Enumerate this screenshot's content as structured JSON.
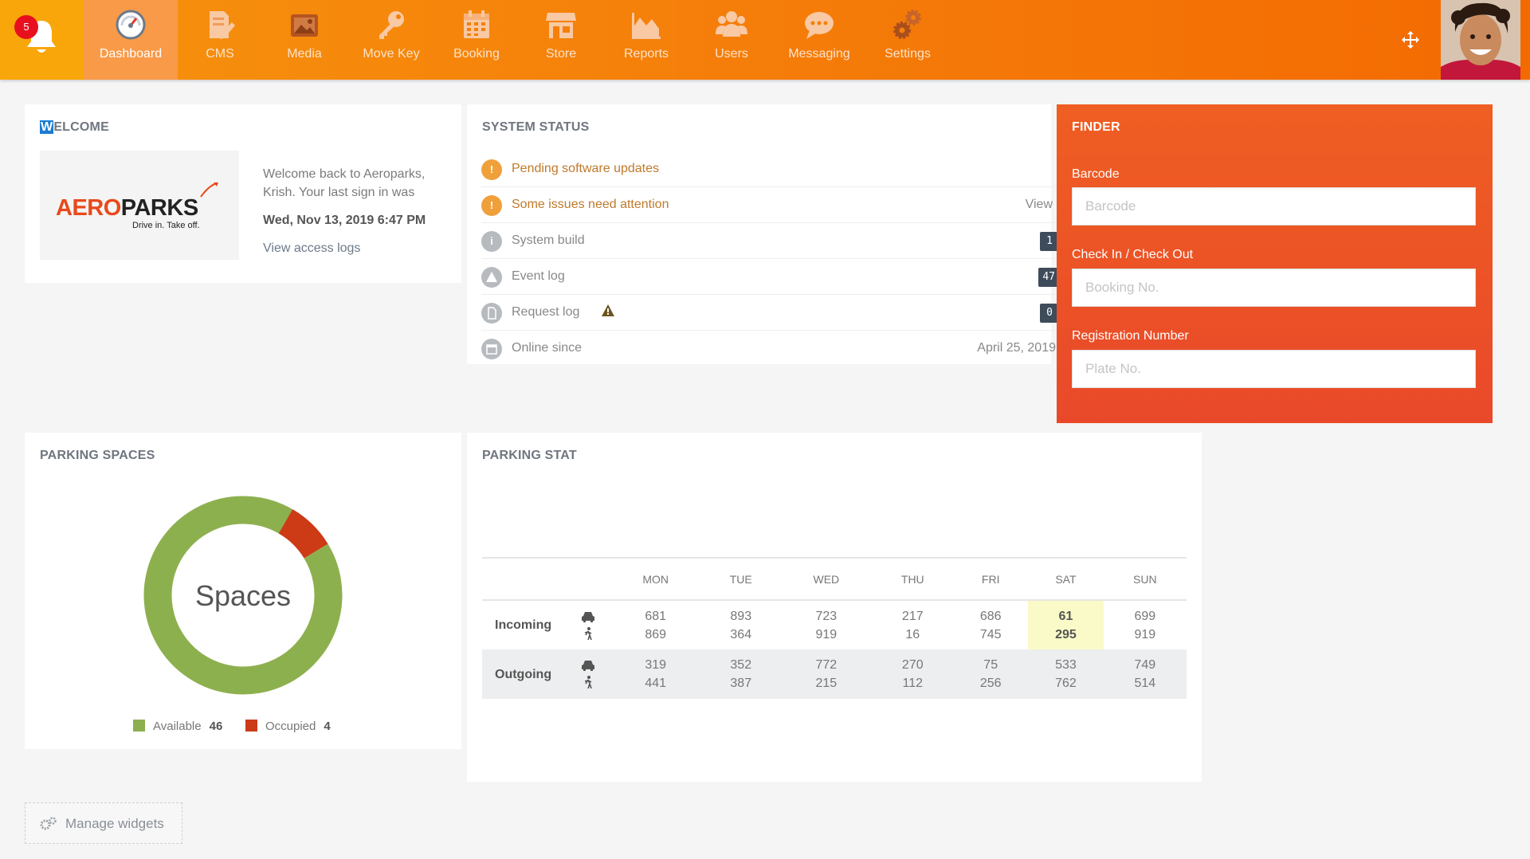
{
  "nav": {
    "notification_count": "5",
    "items": [
      {
        "label": "Dashboard",
        "icon": "speedometer-icon"
      },
      {
        "label": "CMS",
        "icon": "document-edit-icon"
      },
      {
        "label": "Media",
        "icon": "media-icon"
      },
      {
        "label": "Move Key",
        "icon": "key-icon"
      },
      {
        "label": "Booking",
        "icon": "calendar-icon"
      },
      {
        "label": "Store",
        "icon": "store-icon"
      },
      {
        "label": "Reports",
        "icon": "area-chart-icon"
      },
      {
        "label": "Users",
        "icon": "users-icon"
      },
      {
        "label": "Messaging",
        "icon": "chat-icon"
      },
      {
        "label": "Settings",
        "icon": "gears-icon"
      }
    ],
    "active": "Dashboard"
  },
  "welcome": {
    "title_first": "W",
    "title_rest": "ELCOME",
    "logo_text_aero": "AERO",
    "logo_text_parks": "PARKS",
    "logo_tagline": "Drive in. Take off.",
    "message": "Welcome back to Aeroparks, Krish. Your last sign in was",
    "last_signin": "Wed, Nov 13, 2019 6:47 PM",
    "access_logs_link": "View access logs"
  },
  "system_status": {
    "title": "SYSTEM STATUS",
    "rows": [
      {
        "label": "Pending software updates",
        "icon": "exclamation-icon"
      },
      {
        "label": "Some issues need attention",
        "icon": "exclamation-icon",
        "action": "View"
      },
      {
        "label": "System build",
        "icon": "info-icon",
        "count": "1"
      },
      {
        "label": "Event log",
        "icon": "warning-icon",
        "count": "47"
      },
      {
        "label": "Request log",
        "icon": "file-icon",
        "count": "0"
      },
      {
        "label": "Online since",
        "icon": "calendar-icon",
        "value": "April 25, 2019"
      }
    ]
  },
  "finder": {
    "title": "FINDER",
    "barcode_label": "Barcode",
    "barcode_placeholder": "Barcode",
    "checkin_label": "Check In / Check Out",
    "checkin_placeholder": "Booking No.",
    "registration_label": "Registration Number",
    "registration_placeholder": "Plate No."
  },
  "parking_spaces": {
    "title": "PARKING SPACES",
    "center_label": "Spaces",
    "available_label": "Available",
    "available_count": "46",
    "occupied_label": "Occupied",
    "occupied_count": "4",
    "available_value": 46,
    "occupied_value": 4,
    "available_color": "#8db04e",
    "occupied_color": "#cc3a16"
  },
  "parking_stat": {
    "title": "PARKING STAT",
    "days": [
      "MON",
      "TUE",
      "WED",
      "THU",
      "FRI",
      "SAT",
      "SUN"
    ],
    "incoming_label": "Incoming",
    "outgoing_label": "Outgoing",
    "incoming_cars": [
      "681",
      "893",
      "723",
      "217",
      "686",
      "61",
      "699"
    ],
    "incoming_walk": [
      "869",
      "364",
      "919",
      "16",
      "745",
      "295",
      "919"
    ],
    "outgoing_cars": [
      "319",
      "352",
      "772",
      "270",
      "75",
      "533",
      "749"
    ],
    "outgoing_walk": [
      "441",
      "387",
      "215",
      "112",
      "256",
      "762",
      "514"
    ],
    "highlight_day": "SAT"
  },
  "manage_widgets": "Manage widgets",
  "colors": {
    "nav_orange": "#f57f0a",
    "finder_red": "#e9492a",
    "badge_red": "#e8101f",
    "highlight_yellow": "#fafac8"
  }
}
